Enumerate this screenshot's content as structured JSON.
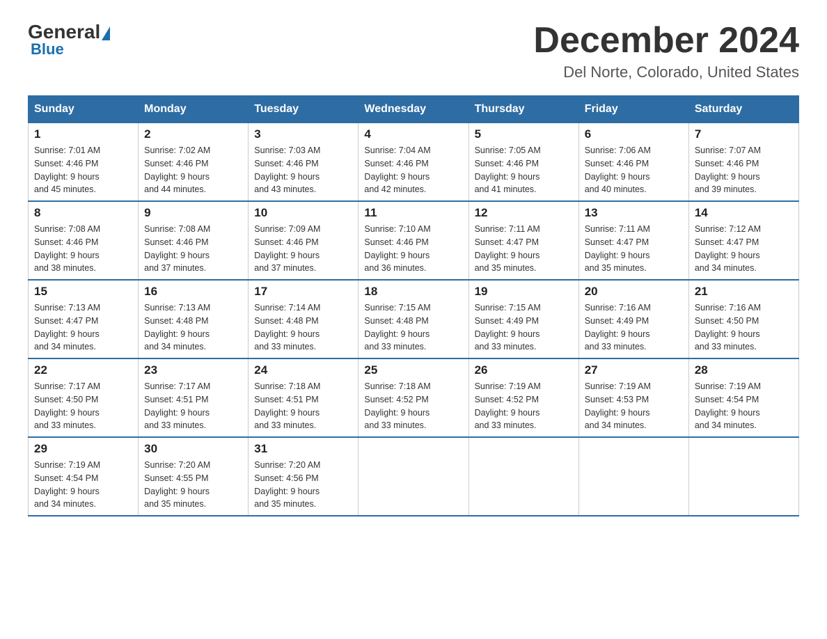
{
  "logo": {
    "general": "General",
    "blue": "Blue",
    "arrow_unicode": "▶"
  },
  "title": {
    "month_year": "December 2024",
    "location": "Del Norte, Colorado, United States"
  },
  "header_days": [
    "Sunday",
    "Monday",
    "Tuesday",
    "Wednesday",
    "Thursday",
    "Friday",
    "Saturday"
  ],
  "weeks": [
    [
      {
        "day": "1",
        "sunrise": "7:01 AM",
        "sunset": "4:46 PM",
        "daylight": "9 hours and 45 minutes."
      },
      {
        "day": "2",
        "sunrise": "7:02 AM",
        "sunset": "4:46 PM",
        "daylight": "9 hours and 44 minutes."
      },
      {
        "day": "3",
        "sunrise": "7:03 AM",
        "sunset": "4:46 PM",
        "daylight": "9 hours and 43 minutes."
      },
      {
        "day": "4",
        "sunrise": "7:04 AM",
        "sunset": "4:46 PM",
        "daylight": "9 hours and 42 minutes."
      },
      {
        "day": "5",
        "sunrise": "7:05 AM",
        "sunset": "4:46 PM",
        "daylight": "9 hours and 41 minutes."
      },
      {
        "day": "6",
        "sunrise": "7:06 AM",
        "sunset": "4:46 PM",
        "daylight": "9 hours and 40 minutes."
      },
      {
        "day": "7",
        "sunrise": "7:07 AM",
        "sunset": "4:46 PM",
        "daylight": "9 hours and 39 minutes."
      }
    ],
    [
      {
        "day": "8",
        "sunrise": "7:08 AM",
        "sunset": "4:46 PM",
        "daylight": "9 hours and 38 minutes."
      },
      {
        "day": "9",
        "sunrise": "7:08 AM",
        "sunset": "4:46 PM",
        "daylight": "9 hours and 37 minutes."
      },
      {
        "day": "10",
        "sunrise": "7:09 AM",
        "sunset": "4:46 PM",
        "daylight": "9 hours and 37 minutes."
      },
      {
        "day": "11",
        "sunrise": "7:10 AM",
        "sunset": "4:46 PM",
        "daylight": "9 hours and 36 minutes."
      },
      {
        "day": "12",
        "sunrise": "7:11 AM",
        "sunset": "4:47 PM",
        "daylight": "9 hours and 35 minutes."
      },
      {
        "day": "13",
        "sunrise": "7:11 AM",
        "sunset": "4:47 PM",
        "daylight": "9 hours and 35 minutes."
      },
      {
        "day": "14",
        "sunrise": "7:12 AM",
        "sunset": "4:47 PM",
        "daylight": "9 hours and 34 minutes."
      }
    ],
    [
      {
        "day": "15",
        "sunrise": "7:13 AM",
        "sunset": "4:47 PM",
        "daylight": "9 hours and 34 minutes."
      },
      {
        "day": "16",
        "sunrise": "7:13 AM",
        "sunset": "4:48 PM",
        "daylight": "9 hours and 34 minutes."
      },
      {
        "day": "17",
        "sunrise": "7:14 AM",
        "sunset": "4:48 PM",
        "daylight": "9 hours and 33 minutes."
      },
      {
        "day": "18",
        "sunrise": "7:15 AM",
        "sunset": "4:48 PM",
        "daylight": "9 hours and 33 minutes."
      },
      {
        "day": "19",
        "sunrise": "7:15 AM",
        "sunset": "4:49 PM",
        "daylight": "9 hours and 33 minutes."
      },
      {
        "day": "20",
        "sunrise": "7:16 AM",
        "sunset": "4:49 PM",
        "daylight": "9 hours and 33 minutes."
      },
      {
        "day": "21",
        "sunrise": "7:16 AM",
        "sunset": "4:50 PM",
        "daylight": "9 hours and 33 minutes."
      }
    ],
    [
      {
        "day": "22",
        "sunrise": "7:17 AM",
        "sunset": "4:50 PM",
        "daylight": "9 hours and 33 minutes."
      },
      {
        "day": "23",
        "sunrise": "7:17 AM",
        "sunset": "4:51 PM",
        "daylight": "9 hours and 33 minutes."
      },
      {
        "day": "24",
        "sunrise": "7:18 AM",
        "sunset": "4:51 PM",
        "daylight": "9 hours and 33 minutes."
      },
      {
        "day": "25",
        "sunrise": "7:18 AM",
        "sunset": "4:52 PM",
        "daylight": "9 hours and 33 minutes."
      },
      {
        "day": "26",
        "sunrise": "7:19 AM",
        "sunset": "4:52 PM",
        "daylight": "9 hours and 33 minutes."
      },
      {
        "day": "27",
        "sunrise": "7:19 AM",
        "sunset": "4:53 PM",
        "daylight": "9 hours and 34 minutes."
      },
      {
        "day": "28",
        "sunrise": "7:19 AM",
        "sunset": "4:54 PM",
        "daylight": "9 hours and 34 minutes."
      }
    ],
    [
      {
        "day": "29",
        "sunrise": "7:19 AM",
        "sunset": "4:54 PM",
        "daylight": "9 hours and 34 minutes."
      },
      {
        "day": "30",
        "sunrise": "7:20 AM",
        "sunset": "4:55 PM",
        "daylight": "9 hours and 35 minutes."
      },
      {
        "day": "31",
        "sunrise": "7:20 AM",
        "sunset": "4:56 PM",
        "daylight": "9 hours and 35 minutes."
      },
      null,
      null,
      null,
      null
    ]
  ],
  "labels": {
    "sunrise_prefix": "Sunrise: ",
    "sunset_prefix": "Sunset: ",
    "daylight_prefix": "Daylight: "
  }
}
